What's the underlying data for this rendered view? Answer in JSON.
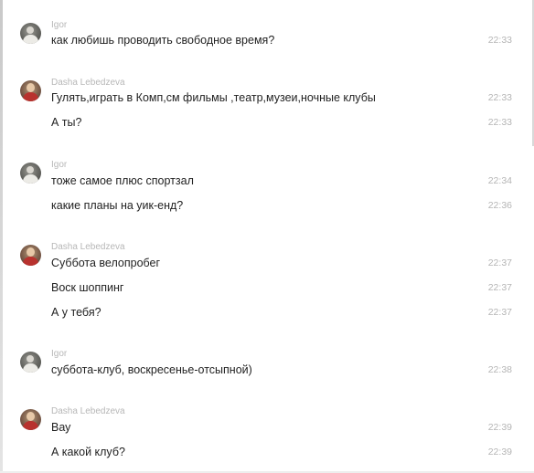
{
  "messages": [
    {
      "sender": "Igor",
      "avatar": "igor-avatar",
      "lines": [
        {
          "text": "как любишь проводить свободное время?",
          "time": "22:33"
        }
      ]
    },
    {
      "sender": "Dasha Lebedzeva",
      "avatar": "dasha-avatar",
      "lines": [
        {
          "text": "Гулять,играть в Комп,см фильмы ,театр,музеи,ночные клубы",
          "time": "22:33"
        },
        {
          "text": "А ты?",
          "time": "22:33"
        }
      ]
    },
    {
      "sender": "Igor",
      "avatar": "igor-avatar",
      "lines": [
        {
          "text": "тоже самое плюс спортзал",
          "time": "22:34"
        },
        {
          "text": "какие планы на уик-енд?",
          "time": "22:36"
        }
      ]
    },
    {
      "sender": "Dasha Lebedzeva",
      "avatar": "dasha-avatar",
      "lines": [
        {
          "text": "Суббота велопробег",
          "time": "22:37"
        },
        {
          "text": "Воск шоппинг",
          "time": "22:37"
        },
        {
          "text": "А у тебя?",
          "time": "22:37"
        }
      ]
    },
    {
      "sender": "Igor",
      "avatar": "igor-avatar",
      "lines": [
        {
          "text": "суббота-клуб, воскресенье-отсыпной)",
          "time": "22:38"
        }
      ]
    },
    {
      "sender": "Dasha Lebedzeva",
      "avatar": "dasha-avatar",
      "lines": [
        {
          "text": "Вау",
          "time": "22:39"
        },
        {
          "text": "А какой клуб?",
          "time": "22:39"
        }
      ]
    }
  ],
  "colors": {
    "sender_name": "#b7b7b7",
    "message_text": "#222222",
    "timestamp": "#b5b5b5",
    "dasha_avatar_accent": "#b8322e"
  }
}
